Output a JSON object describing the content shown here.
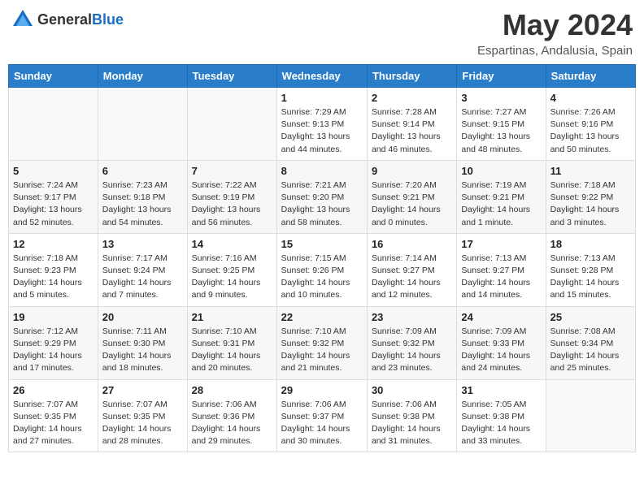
{
  "header": {
    "logo_general": "General",
    "logo_blue": "Blue",
    "title": "May 2024",
    "location": "Espartinas, Andalusia, Spain"
  },
  "weekdays": [
    "Sunday",
    "Monday",
    "Tuesday",
    "Wednesday",
    "Thursday",
    "Friday",
    "Saturday"
  ],
  "weeks": [
    [
      {
        "date": "",
        "info": ""
      },
      {
        "date": "",
        "info": ""
      },
      {
        "date": "",
        "info": ""
      },
      {
        "date": "1",
        "info": "Sunrise: 7:29 AM\nSunset: 9:13 PM\nDaylight: 13 hours\nand 44 minutes."
      },
      {
        "date": "2",
        "info": "Sunrise: 7:28 AM\nSunset: 9:14 PM\nDaylight: 13 hours\nand 46 minutes."
      },
      {
        "date": "3",
        "info": "Sunrise: 7:27 AM\nSunset: 9:15 PM\nDaylight: 13 hours\nand 48 minutes."
      },
      {
        "date": "4",
        "info": "Sunrise: 7:26 AM\nSunset: 9:16 PM\nDaylight: 13 hours\nand 50 minutes."
      }
    ],
    [
      {
        "date": "5",
        "info": "Sunrise: 7:24 AM\nSunset: 9:17 PM\nDaylight: 13 hours\nand 52 minutes."
      },
      {
        "date": "6",
        "info": "Sunrise: 7:23 AM\nSunset: 9:18 PM\nDaylight: 13 hours\nand 54 minutes."
      },
      {
        "date": "7",
        "info": "Sunrise: 7:22 AM\nSunset: 9:19 PM\nDaylight: 13 hours\nand 56 minutes."
      },
      {
        "date": "8",
        "info": "Sunrise: 7:21 AM\nSunset: 9:20 PM\nDaylight: 13 hours\nand 58 minutes."
      },
      {
        "date": "9",
        "info": "Sunrise: 7:20 AM\nSunset: 9:21 PM\nDaylight: 14 hours\nand 0 minutes."
      },
      {
        "date": "10",
        "info": "Sunrise: 7:19 AM\nSunset: 9:21 PM\nDaylight: 14 hours\nand 1 minute."
      },
      {
        "date": "11",
        "info": "Sunrise: 7:18 AM\nSunset: 9:22 PM\nDaylight: 14 hours\nand 3 minutes."
      }
    ],
    [
      {
        "date": "12",
        "info": "Sunrise: 7:18 AM\nSunset: 9:23 PM\nDaylight: 14 hours\nand 5 minutes."
      },
      {
        "date": "13",
        "info": "Sunrise: 7:17 AM\nSunset: 9:24 PM\nDaylight: 14 hours\nand 7 minutes."
      },
      {
        "date": "14",
        "info": "Sunrise: 7:16 AM\nSunset: 9:25 PM\nDaylight: 14 hours\nand 9 minutes."
      },
      {
        "date": "15",
        "info": "Sunrise: 7:15 AM\nSunset: 9:26 PM\nDaylight: 14 hours\nand 10 minutes."
      },
      {
        "date": "16",
        "info": "Sunrise: 7:14 AM\nSunset: 9:27 PM\nDaylight: 14 hours\nand 12 minutes."
      },
      {
        "date": "17",
        "info": "Sunrise: 7:13 AM\nSunset: 9:27 PM\nDaylight: 14 hours\nand 14 minutes."
      },
      {
        "date": "18",
        "info": "Sunrise: 7:13 AM\nSunset: 9:28 PM\nDaylight: 14 hours\nand 15 minutes."
      }
    ],
    [
      {
        "date": "19",
        "info": "Sunrise: 7:12 AM\nSunset: 9:29 PM\nDaylight: 14 hours\nand 17 minutes."
      },
      {
        "date": "20",
        "info": "Sunrise: 7:11 AM\nSunset: 9:30 PM\nDaylight: 14 hours\nand 18 minutes."
      },
      {
        "date": "21",
        "info": "Sunrise: 7:10 AM\nSunset: 9:31 PM\nDaylight: 14 hours\nand 20 minutes."
      },
      {
        "date": "22",
        "info": "Sunrise: 7:10 AM\nSunset: 9:32 PM\nDaylight: 14 hours\nand 21 minutes."
      },
      {
        "date": "23",
        "info": "Sunrise: 7:09 AM\nSunset: 9:32 PM\nDaylight: 14 hours\nand 23 minutes."
      },
      {
        "date": "24",
        "info": "Sunrise: 7:09 AM\nSunset: 9:33 PM\nDaylight: 14 hours\nand 24 minutes."
      },
      {
        "date": "25",
        "info": "Sunrise: 7:08 AM\nSunset: 9:34 PM\nDaylight: 14 hours\nand 25 minutes."
      }
    ],
    [
      {
        "date": "26",
        "info": "Sunrise: 7:07 AM\nSunset: 9:35 PM\nDaylight: 14 hours\nand 27 minutes."
      },
      {
        "date": "27",
        "info": "Sunrise: 7:07 AM\nSunset: 9:35 PM\nDaylight: 14 hours\nand 28 minutes."
      },
      {
        "date": "28",
        "info": "Sunrise: 7:06 AM\nSunset: 9:36 PM\nDaylight: 14 hours\nand 29 minutes."
      },
      {
        "date": "29",
        "info": "Sunrise: 7:06 AM\nSunset: 9:37 PM\nDaylight: 14 hours\nand 30 minutes."
      },
      {
        "date": "30",
        "info": "Sunrise: 7:06 AM\nSunset: 9:38 PM\nDaylight: 14 hours\nand 31 minutes."
      },
      {
        "date": "31",
        "info": "Sunrise: 7:05 AM\nSunset: 9:38 PM\nDaylight: 14 hours\nand 33 minutes."
      },
      {
        "date": "",
        "info": ""
      }
    ]
  ]
}
